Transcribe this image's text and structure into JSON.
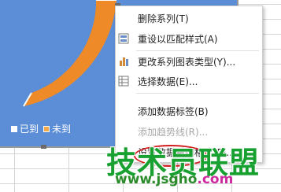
{
  "chart": {
    "colors": {
      "background": "#5b8ed6",
      "series_a": "#5b8ed6",
      "series_b": "#ef8a28"
    },
    "legend": [
      {
        "label": "已到",
        "color": "#ffffff"
      },
      {
        "label": "未到",
        "color": "#f2a94a"
      }
    ]
  },
  "context_menu": {
    "items": [
      {
        "label": "删除系列(T)",
        "icon": "",
        "enabled": true
      },
      {
        "label": "重设以匹配样式(A)",
        "icon": "reset-style-icon",
        "enabled": true
      },
      {
        "label": "更改系列图表类型(Y)...",
        "icon": "chart-type-icon",
        "enabled": true
      },
      {
        "label": "选择数据(E)...",
        "icon": "select-data-icon",
        "enabled": true
      },
      {
        "label": "添加数据标签(B)",
        "icon": "",
        "enabled": true
      },
      {
        "label": "添加趋势线(R)...",
        "icon": "",
        "enabled": false
      },
      {
        "label": "设置数据系列格式(F)...",
        "icon": "",
        "enabled": true
      }
    ]
  },
  "watermark": {
    "text": "技术员联盟",
    "url_green": "www.jsgho",
    "url_pink": ".com"
  }
}
